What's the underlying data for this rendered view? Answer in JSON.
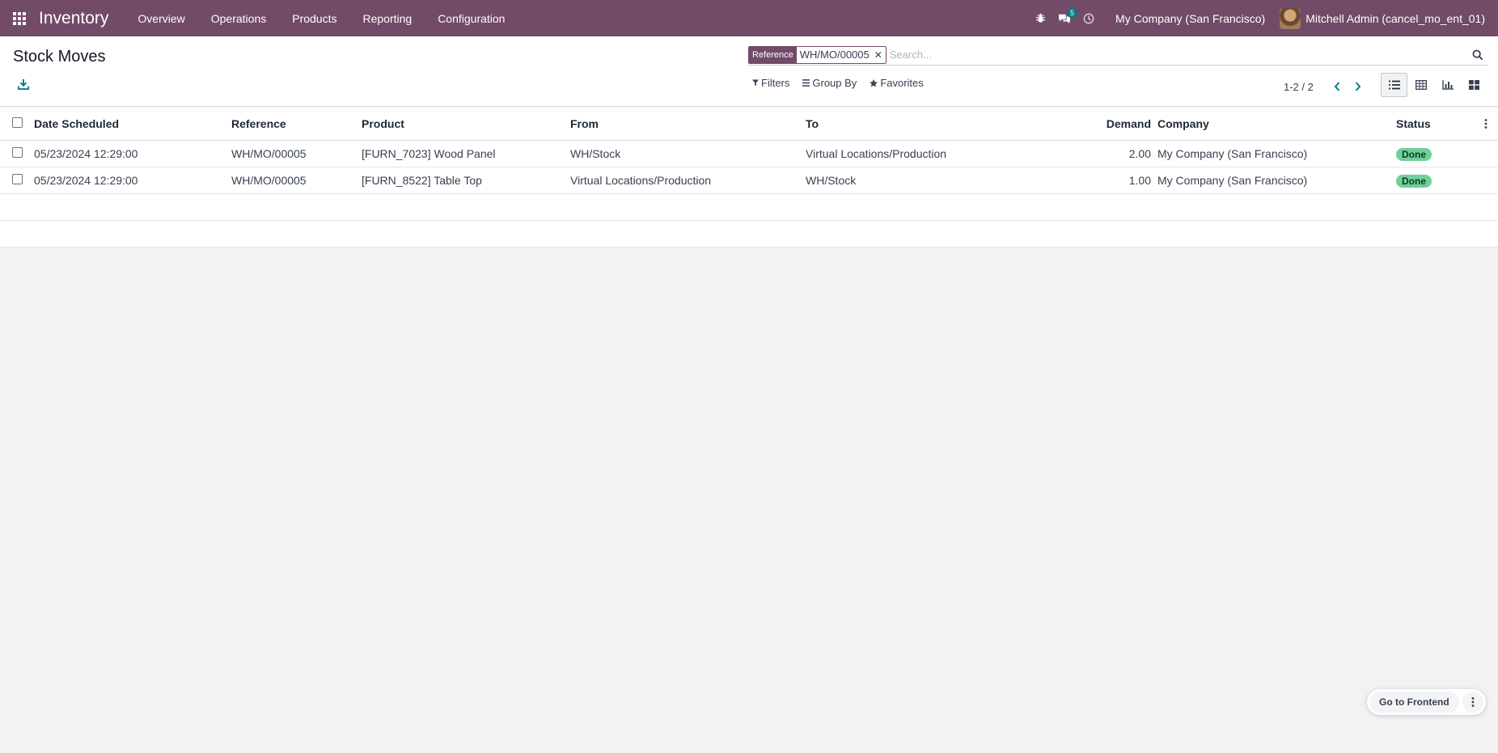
{
  "navbar": {
    "app_name": "Inventory",
    "menu": [
      "Overview",
      "Operations",
      "Products",
      "Reporting",
      "Configuration"
    ],
    "messages_count": "5",
    "company": "My Company (San Francisco)",
    "user": "Mitchell Admin (cancel_mo_ent_01)"
  },
  "control_panel": {
    "title": "Stock Moves",
    "facet_label": "Reference",
    "facet_value": "WH/MO/00005",
    "search_placeholder": "Search...",
    "filters_label": "Filters",
    "group_by_label": "Group By",
    "favorites_label": "Favorites",
    "pager_value": "1-2 / 2"
  },
  "list": {
    "columns": [
      "Date Scheduled",
      "Reference",
      "Product",
      "From",
      "To",
      "Demand",
      "Company",
      "Status"
    ],
    "rows": [
      {
        "date": "05/23/2024 12:29:00",
        "reference": "WH/MO/00005",
        "product": "[FURN_7023] Wood Panel",
        "from": "WH/Stock",
        "to": "Virtual Locations/Production",
        "demand": "2.00",
        "company": "My Company (San Francisco)",
        "status": "Done"
      },
      {
        "date": "05/23/2024 12:29:00",
        "reference": "WH/MO/00005",
        "product": "[FURN_8522] Table Top",
        "from": "Virtual Locations/Production",
        "to": "WH/Stock",
        "demand": "1.00",
        "company": "My Company (San Francisco)",
        "status": "Done"
      }
    ]
  },
  "floating": {
    "go_frontend_label": "Go to Frontend"
  },
  "colors": {
    "brand": "#714b67",
    "badge": "#017e84",
    "status_done": "#6fcf97"
  }
}
